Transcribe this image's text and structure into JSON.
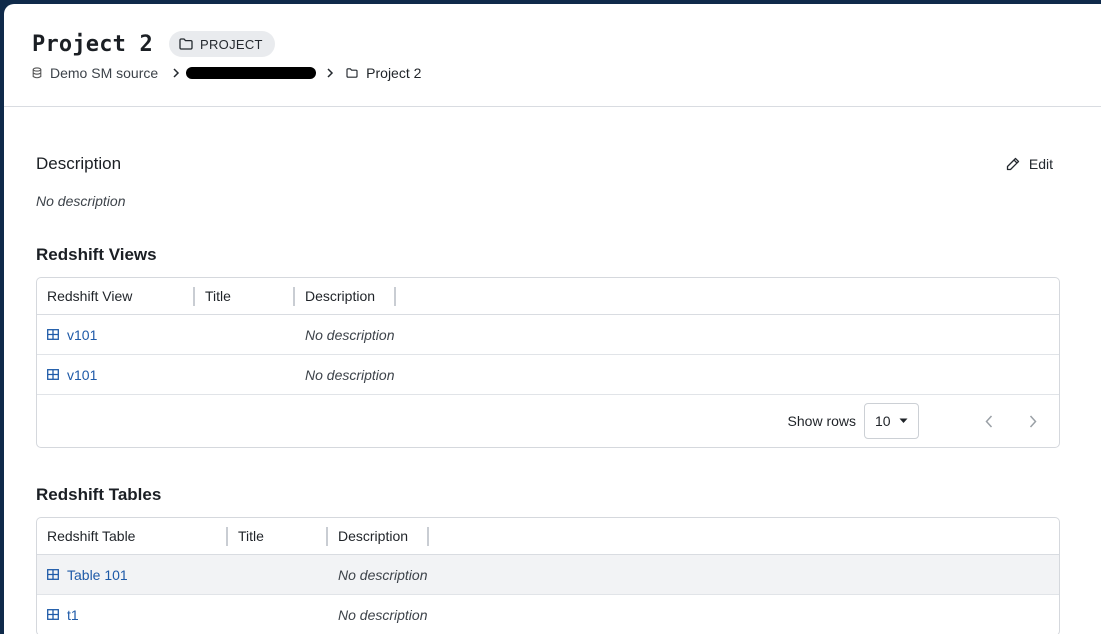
{
  "header": {
    "title": "Project 2",
    "badge": "PROJECT",
    "breadcrumb": {
      "source": "Demo SM source",
      "current": "Project 2"
    }
  },
  "description": {
    "title": "Description",
    "edit_label": "Edit",
    "text": "No description"
  },
  "views": {
    "title": "Redshift Views",
    "columns": [
      "Redshift View",
      "Title",
      "Description"
    ],
    "rows": [
      {
        "name": "v101",
        "title": "",
        "description": "No description"
      },
      {
        "name": "v101",
        "title": "",
        "description": "No description"
      }
    ],
    "footer": {
      "show_rows_label": "Show rows",
      "rows_value": "10"
    }
  },
  "tables": {
    "title": "Redshift Tables",
    "columns": [
      "Redshift Table",
      "Title",
      "Description"
    ],
    "rows": [
      {
        "name": "Table 101",
        "title": "",
        "description": "No description"
      },
      {
        "name": "t1",
        "title": "",
        "description": "No description"
      }
    ]
  },
  "icons": {
    "badge": "folder-icon",
    "source": "database-icon",
    "current": "folder-icon",
    "edit": "pencil-icon",
    "row": "table-grid-icon"
  },
  "colors": {
    "link": "#1e5aa8",
    "frame": "#0f2a4a"
  }
}
